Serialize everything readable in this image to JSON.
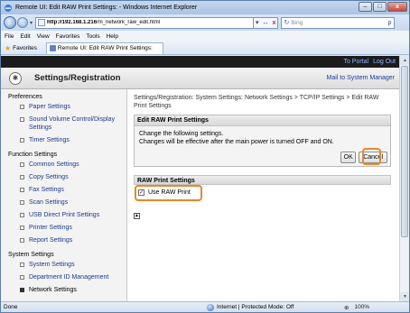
{
  "window": {
    "title": "Remote UI: Edit RAW Print Settings: - Windows Internet Explorer",
    "min_glyph": "–",
    "max_glyph": "□",
    "close_glyph": "x"
  },
  "addressbar": {
    "back_glyph": "←",
    "fwd_glyph": "→",
    "url_bold": "http://192.168.1.216",
    "url_rest": "/m_network_raw_edit.html",
    "refresh_glyph": "↻",
    "go_glyph": "↔",
    "stop_glyph": "x",
    "search_placeholder": "Bing",
    "search_glyph": "ρ"
  },
  "menubar": {
    "items": [
      "File",
      "Edit",
      "View",
      "Favorites",
      "Tools",
      "Help"
    ]
  },
  "favorites": {
    "label": "Favorites",
    "tab_label": "Remote UI: Edit RAW Print Settings:"
  },
  "header": {
    "links": [
      "To Portal",
      "Log Out"
    ],
    "title": "Settings/Registration",
    "mail_link": "Mail to System Manager"
  },
  "sidebar": {
    "sections": [
      {
        "title": "Preferences",
        "items": [
          "Paper Settings",
          "Sound Volume Control/Display Settings",
          "Timer Settings"
        ]
      },
      {
        "title": "Function Settings",
        "items": [
          "Common Settings",
          "Copy Settings",
          "Fax Settings",
          "Scan Settings",
          "USB Direct Print Settings",
          "Printer Settings",
          "Report Settings"
        ]
      },
      {
        "title": "System Settings",
        "items": [
          "System Settings",
          "Department ID Management",
          "Network Settings"
        ]
      }
    ]
  },
  "main": {
    "breadcrumb": "Settings/Registration: System Settings: Network Settings > TCP/IP Settings > Edit RAW Print Settings",
    "panel_title": "Edit RAW Print Settings",
    "message_1": "Change the following settings.",
    "message_2": "Changes will be effective after the main power is turned OFF and ON.",
    "ok_label": "OK",
    "cancel_label": "Cancel",
    "section_title": "RAW Print Settings",
    "use_raw_print_label": "Use RAW Print",
    "use_raw_print_checked": true,
    "checkmark": "✓",
    "top_glyph": "▲"
  },
  "statusbar": {
    "left": "Done",
    "zone": "Internet | Protected Mode: Off",
    "zone_glyph": "⊕",
    "dropdown_glyph": "▾",
    "zoom": "100%"
  },
  "colors": {
    "highlight": "#e3892c",
    "link": "#1b3a8a",
    "header_bar": "#1c1c1c"
  }
}
